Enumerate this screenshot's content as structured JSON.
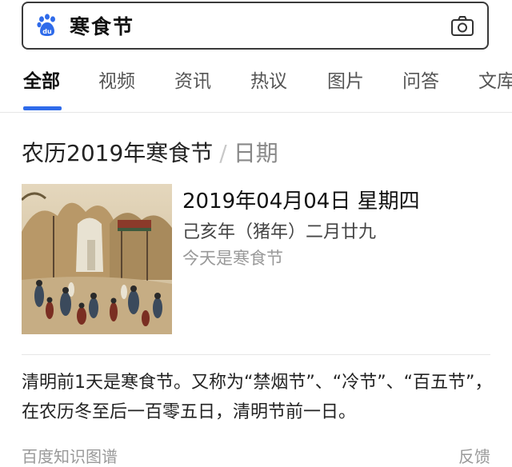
{
  "search": {
    "query": "寒食节",
    "logo_icon": "baidu-paw-icon",
    "camera_icon": "camera-icon",
    "logo_color": "#2f6bea"
  },
  "tabs": [
    {
      "label": "全部",
      "active": true
    },
    {
      "label": "视频",
      "active": false
    },
    {
      "label": "资讯",
      "active": false
    },
    {
      "label": "热议",
      "active": false
    },
    {
      "label": "图片",
      "active": false
    },
    {
      "label": "问答",
      "active": false
    },
    {
      "label": "文库",
      "active": false
    }
  ],
  "accent_color": "#2f6bea",
  "card": {
    "title": "农历2019年寒食节",
    "separator": "/",
    "subtitle": "日期",
    "date": "2019年04月04日 星期四",
    "lunar_date": "己亥年（猪年）二月廿九",
    "today_note": "今天是寒食节",
    "description": "清明前1天是寒食节。又称为“禁烟节”、“冷节”、“百五节”，在农历冬至后一百零五日，清明节前一日。",
    "source": "百度知识图谱",
    "feedback": "反馈"
  }
}
